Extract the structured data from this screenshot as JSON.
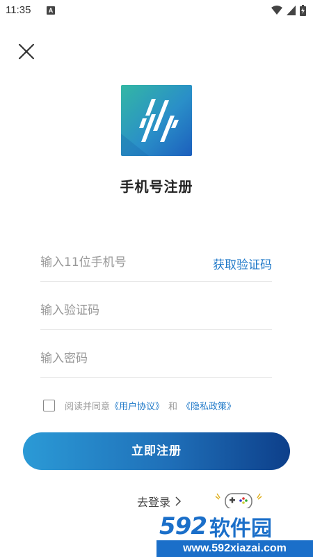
{
  "status_bar": {
    "time": "11:35",
    "notification_icon": "a-letter-icon",
    "icons": [
      "wifi-icon",
      "cell-signal-icon",
      "battery-icon"
    ]
  },
  "header": {
    "close_icon": "close-icon"
  },
  "logo": {
    "icon": "app-logo",
    "colors": {
      "teal": "#2fb2a8",
      "blue": "#1e6fc2"
    }
  },
  "title": "手机号注册",
  "form": {
    "phone": {
      "placeholder": "输入11位手机号",
      "value": ""
    },
    "get_code": "获取验证码",
    "code": {
      "placeholder": "输入验证码",
      "value": ""
    },
    "password": {
      "placeholder": "输入密码",
      "value": ""
    }
  },
  "agreement": {
    "checked": false,
    "prefix": "阅读并同意",
    "user_agreement": "《用户协议》",
    "and": "和",
    "privacy_policy": "《隐私政策》"
  },
  "register_button": "立即注册",
  "login_link": "去登录",
  "watermark": {
    "number": "592",
    "name": "软件园",
    "url": "www.592xiazai.com"
  },
  "colors": {
    "accent": "#1e78c8",
    "button_start": "#2b9ad6",
    "button_end": "#0d3f8a"
  }
}
